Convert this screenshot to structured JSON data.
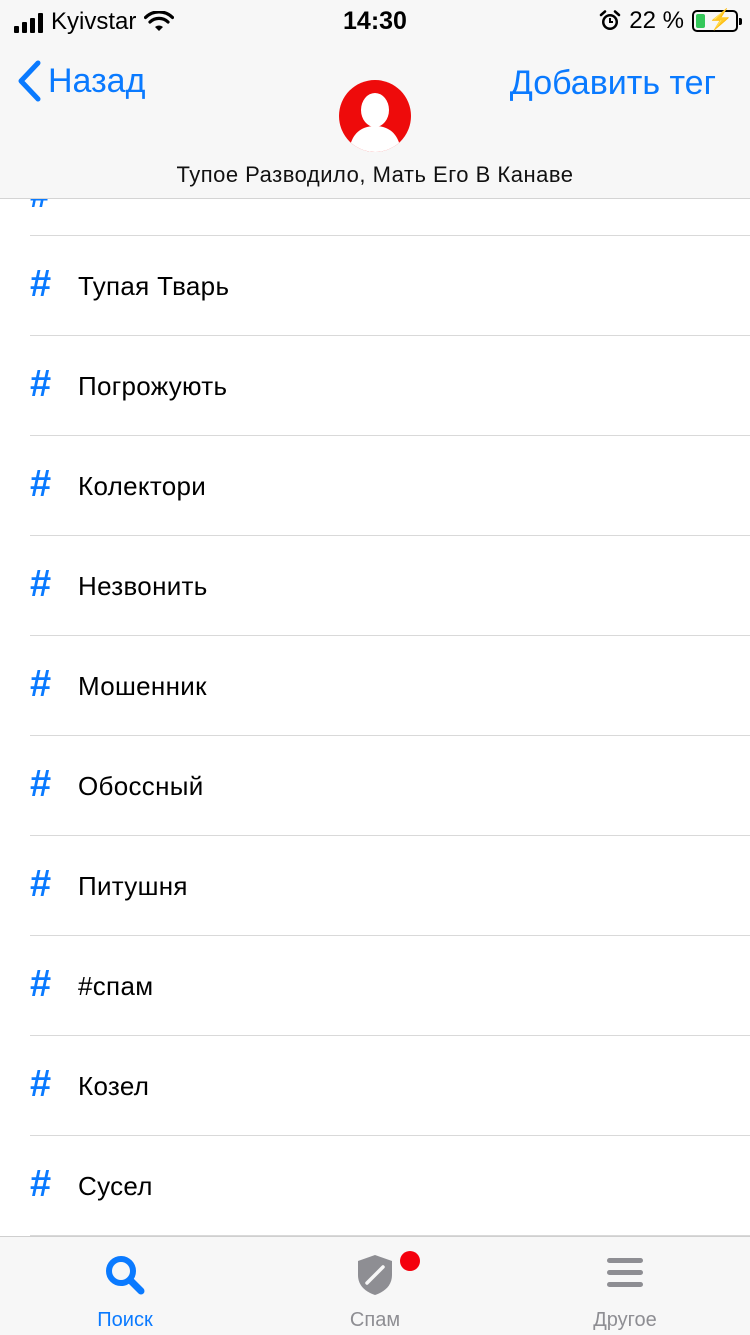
{
  "status_bar": {
    "carrier": "Kyivstar",
    "time": "14:30",
    "battery_percent": "22 %"
  },
  "nav": {
    "back_label": "Назад",
    "add_tag_label": "Добавить тег",
    "contact_name": "Тупое Разводило, Мать Его В Канаве"
  },
  "tags": [
    {
      "label": "Тупая Тварь"
    },
    {
      "label": "Погрожують"
    },
    {
      "label": "Колектори"
    },
    {
      "label": "Незвонить"
    },
    {
      "label": "Мошенник"
    },
    {
      "label": "Обоссный"
    },
    {
      "label": "Питушня"
    },
    {
      "label": "#спам"
    },
    {
      "label": "Козел"
    },
    {
      "label": "Сусел"
    }
  ],
  "tab_bar": {
    "tabs": [
      {
        "label": "Поиск",
        "active": true
      },
      {
        "label": "Спам",
        "active": false
      },
      {
        "label": "Другое",
        "active": false
      }
    ]
  },
  "colors": {
    "accent": "#0a7aff",
    "avatar": "#ee0b0b",
    "badge": "#f4000d",
    "inactive_tab": "#8e8e93"
  }
}
